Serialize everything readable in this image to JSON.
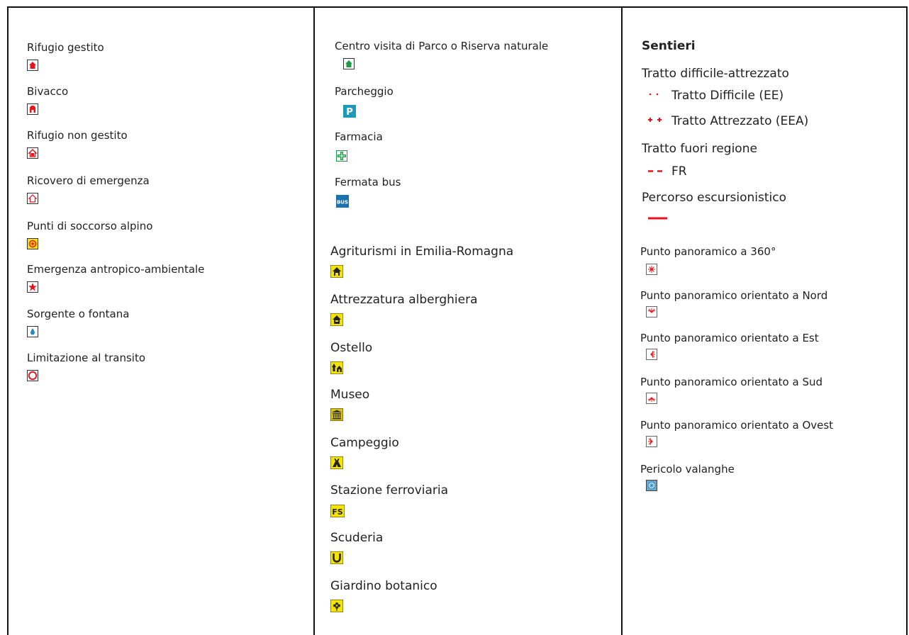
{
  "column1": {
    "items": [
      {
        "label": "Rifugio gestito",
        "icon": "rifugio-gestito-icon"
      },
      {
        "label": "Bivacco",
        "icon": "bivacco-icon"
      },
      {
        "label": "Rifugio non gestito",
        "icon": "rifugio-non-gestito-icon"
      },
      {
        "label": "Ricovero di emergenza",
        "icon": "ricovero-emergenza-icon"
      },
      {
        "label": "Punti di soccorso alpino",
        "icon": "soccorso-alpino-icon"
      },
      {
        "label": "Emergenza antropico-ambientale",
        "icon": "emergenza-star-icon"
      },
      {
        "label": "Sorgente o fontana",
        "icon": "water-drop-icon"
      },
      {
        "label": "Limitazione al transito",
        "icon": "no-transit-circle-icon"
      }
    ]
  },
  "column2": {
    "items_top": [
      {
        "label": "Centro visita di Parco o Riserva naturale",
        "icon": "centro-visita-icon"
      },
      {
        "label": "Parcheggio",
        "icon": "parking-icon"
      },
      {
        "label": "Farmacia",
        "icon": "pharmacy-cross-icon"
      },
      {
        "label": "Fermata bus",
        "icon": "bus-stop-icon"
      }
    ],
    "items_bottom": [
      {
        "label": "Agriturismi in Emilia-Romagna",
        "icon": "agriturismo-icon"
      },
      {
        "label": "Attrezzatura alberghiera",
        "icon": "hotel-icon"
      },
      {
        "label": "Ostello",
        "icon": "hostel-icon"
      },
      {
        "label": "Museo",
        "icon": "museum-icon"
      },
      {
        "label": "Campeggio",
        "icon": "camping-tent-icon"
      },
      {
        "label": "Stazione ferroviaria",
        "icon": "railway-station-icon"
      },
      {
        "label": "Scuderia",
        "icon": "horseshoe-icon"
      },
      {
        "label": "Giardino botanico",
        "icon": "flower-icon"
      }
    ],
    "parking_glyph": "P",
    "bus_glyph": "BUS",
    "fs_glyph": "FS"
  },
  "column3": {
    "sentieri_title": "Sentieri",
    "tratto_difficile_heading": "Tratto difficile-attrezzato",
    "tratto_ee": "Tratto Difficile (EE)",
    "tratto_eea": "Tratto Attrezzato (EEA)",
    "fuori_regione_heading": "Tratto fuori regione",
    "fr_label": "FR",
    "percorso_heading": "Percorso escursionistico",
    "panoramic_items": [
      {
        "label": "Punto panoramico a 360°",
        "icon": "panorama-360-icon"
      },
      {
        "label": "Punto panoramico orientato a Nord",
        "icon": "panorama-north-icon"
      },
      {
        "label": "Punto panoramico orientato a Est",
        "icon": "panorama-east-icon"
      },
      {
        "label": "Punto panoramico orientato a Sud",
        "icon": "panorama-south-icon"
      },
      {
        "label": "Punto panoramico orientato a Ovest",
        "icon": "panorama-west-icon"
      },
      {
        "label": "Pericolo valanghe",
        "icon": "avalanche-snowflake-icon"
      }
    ]
  },
  "colors": {
    "red": "#e8141c",
    "yellow": "#f5e400",
    "green": "#1e9a46",
    "teal": "#1d9ab8",
    "blue": "#2b86c8"
  }
}
